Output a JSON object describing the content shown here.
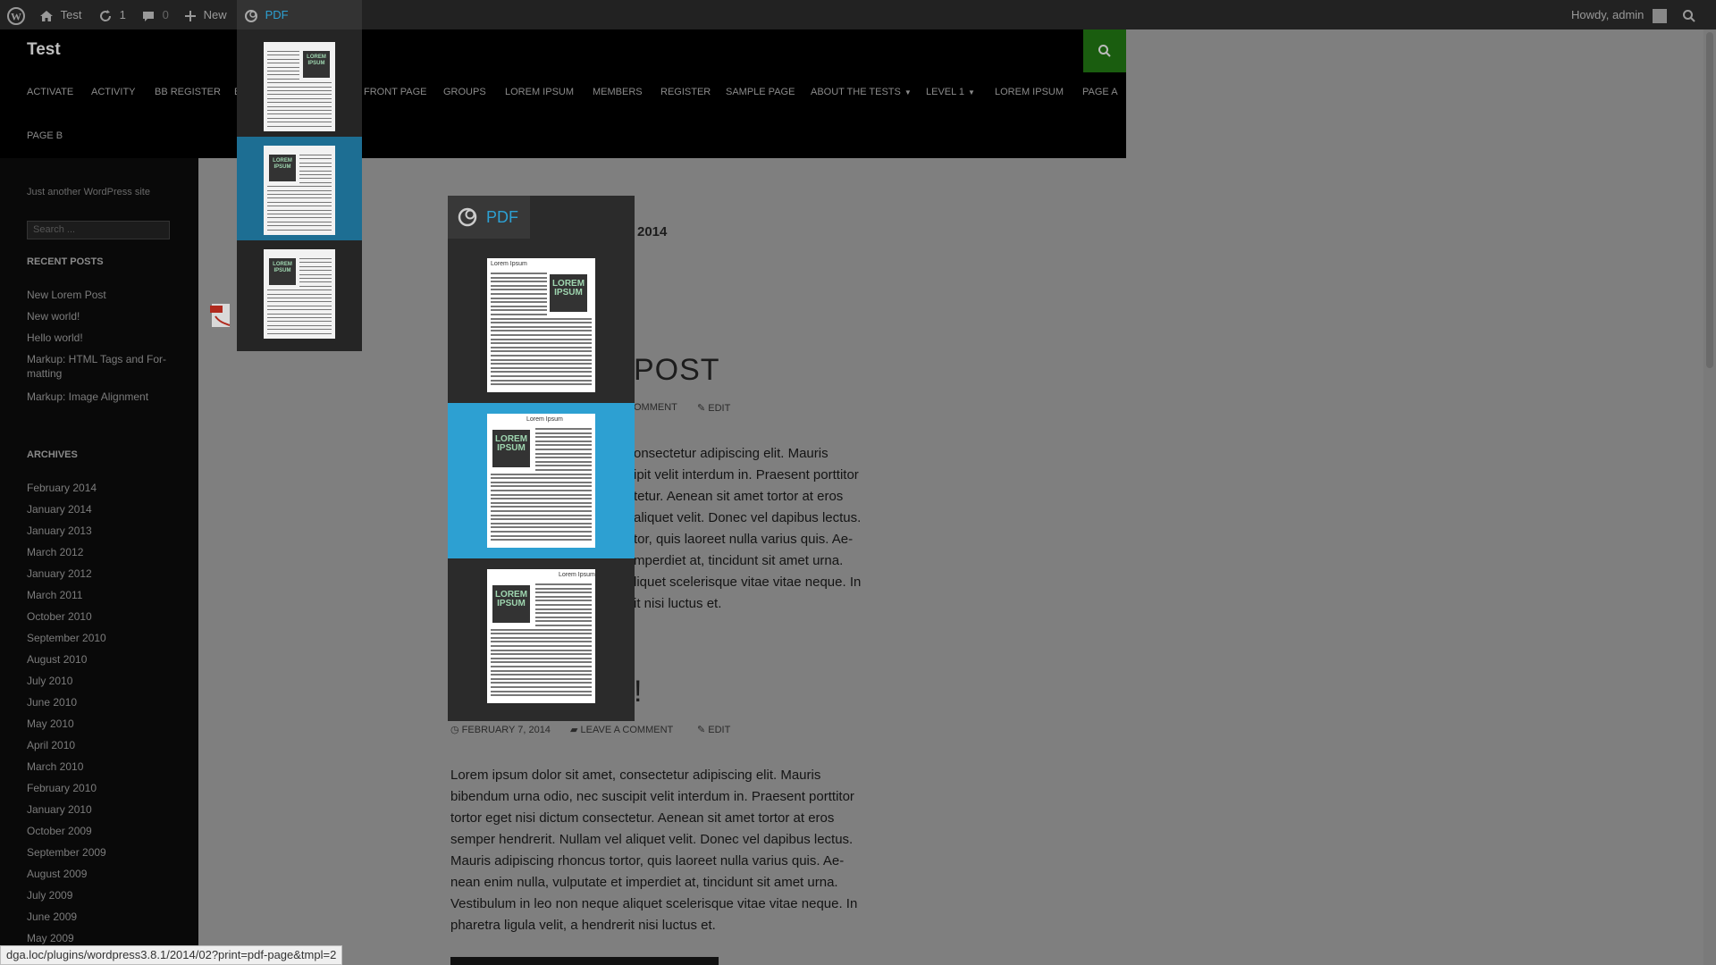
{
  "admin_bar": {
    "site_name": "Test",
    "updates_count": "1",
    "comments_count": "0",
    "new_label": "New",
    "pdf_label": "PDF",
    "howdy": "Howdy, admin"
  },
  "site": {
    "title": "Test",
    "description": "Just another WordPress site"
  },
  "nav": {
    "items": [
      "ACTIVATE",
      "ACTIVITY",
      "BB REGISTER",
      "B",
      "FRONT PAGE",
      "GROUPS",
      "LOREM IPSUM",
      "MEMBERS",
      "REGISTER",
      "SAMPLE PAGE",
      "ABOUT THE TESTS",
      "LEVEL 1",
      "LOREM IPSUM",
      "PAGE A",
      "PAGE B"
    ]
  },
  "sidebar": {
    "search_placeholder": "Search ...",
    "recent_posts_heading": "RECENT POSTS",
    "recent_posts": [
      "New Lorem Post",
      "New world!",
      "Hello world!",
      "Markup: HTML Tags and For-",
      "matting",
      "Markup: Image Alignment"
    ],
    "archives_heading": "ARCHIVES",
    "archives": [
      "February 2014",
      "January 2014",
      "January 2013",
      "March 2012",
      "January 2012",
      "March 2011",
      "October 2010",
      "September 2010",
      "August 2010",
      "July 2010",
      "June 2010",
      "May 2010",
      "April 2010",
      "March 2010",
      "February 2010",
      "January 2010",
      "October 2009",
      "September 2009",
      "August 2009",
      "July 2009",
      "June 2009",
      "May 2009"
    ]
  },
  "content": {
    "archive_title_fragment": "2014",
    "post1_title_fragment": "POST",
    "post1_meta_comment": "OMMENT",
    "post1_meta_edit": "EDIT",
    "post1_lines": [
      "onsectetur adipiscing elit. Mauris",
      "ipit velit interdum in. Praesent porttitor",
      "tetur. Aenean sit amet tortor at eros",
      "aliquet velit. Donec vel dapibus lectus.",
      "tor, quis laoreet nulla varius quis. Ae-",
      "mperdiet at, tincidunt sit amet urna.",
      "liquet scelerisque vitae vitae neque. In",
      "it nisi luctus et."
    ],
    "post2_title_fragment": "!",
    "post2_date": "FEBRUARY 7, 2014",
    "post2_comment": "LEAVE A COMMENT",
    "post2_edit": "EDIT",
    "post2_lines": [
      "Lorem ipsum dolor sit amet, consectetur adipiscing elit. Mauris",
      "bibendum urna odio, nec suscipit velit interdum in. Praesent porttitor",
      "tortor eget nisi dictum consectetur. Aenean sit amet tortor at eros",
      "semper hendrerit. Nullam vel aliquet velit. Donec vel dapibus lectus.",
      "Mauris adipiscing rhoncus tortor, quis laoreet nulla varius quis. Ae-",
      "nean enim nulla, vulputate et imperdiet at, tincidunt sit amet urna.",
      "Vestibulum in leo non neque aliquet scelerisque vitae vitae neque. In",
      "pharetra ligula velit, a hendrerit nisi luctus et."
    ]
  },
  "pdf_panel": {
    "label": "PDF",
    "thumb_title": "Lorem Ipsum",
    "lorem_art": "LOREM IPSUM"
  },
  "status_bar": {
    "url": "dga.loc/plugins/wordpress3.8.1/2014/02?print=pdf-page&tmpl=2"
  },
  "colors": {
    "accent_blue": "#2da0d2",
    "search_green": "#1a5d0f",
    "admin_bar": "#222222"
  }
}
